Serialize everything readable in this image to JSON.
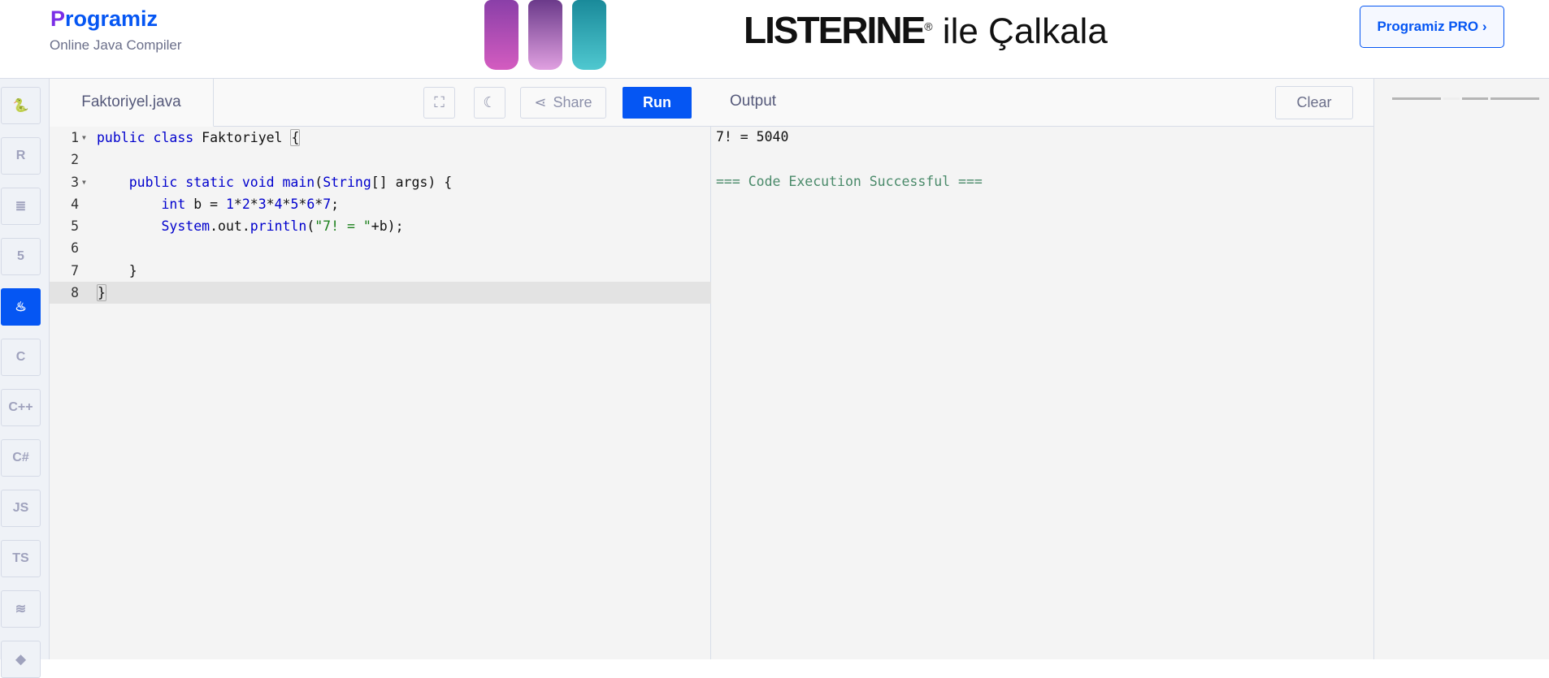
{
  "header": {
    "logo": "Programiz",
    "logo_initial": "P",
    "logo_rest": "rogramiz",
    "subtitle": "Online Java Compiler",
    "ad_brand": "LISTERINE",
    "ad_reg": "®",
    "ad_tagline": " ile Çalkala",
    "pro_button": "Programiz PRO ›"
  },
  "sidebar": {
    "items": [
      {
        "name": "python",
        "label": "🐍"
      },
      {
        "name": "r",
        "label": "R"
      },
      {
        "name": "sql",
        "label": "≣"
      },
      {
        "name": "html",
        "label": "5"
      },
      {
        "name": "java",
        "label": "♨",
        "active": true
      },
      {
        "name": "c",
        "label": "C"
      },
      {
        "name": "cpp",
        "label": "C++"
      },
      {
        "name": "csharp",
        "label": "C#"
      },
      {
        "name": "javascript",
        "label": "JS"
      },
      {
        "name": "typescript",
        "label": "TS"
      },
      {
        "name": "swift",
        "label": "≋"
      },
      {
        "name": "more",
        "label": "◆"
      }
    ]
  },
  "editor": {
    "filename": "Faktoriyel.java",
    "share_label": "Share",
    "run_label": "Run",
    "lines": [
      "1",
      "2",
      "3",
      "4",
      "5",
      "6",
      "7",
      "8"
    ]
  },
  "output": {
    "title": "Output",
    "clear_label": "Clear",
    "lines": [
      "7! = 5040",
      "=== Code Execution Successful ==="
    ]
  },
  "colors": {
    "accent": "#0556f3",
    "success": "#4a8a6a"
  }
}
